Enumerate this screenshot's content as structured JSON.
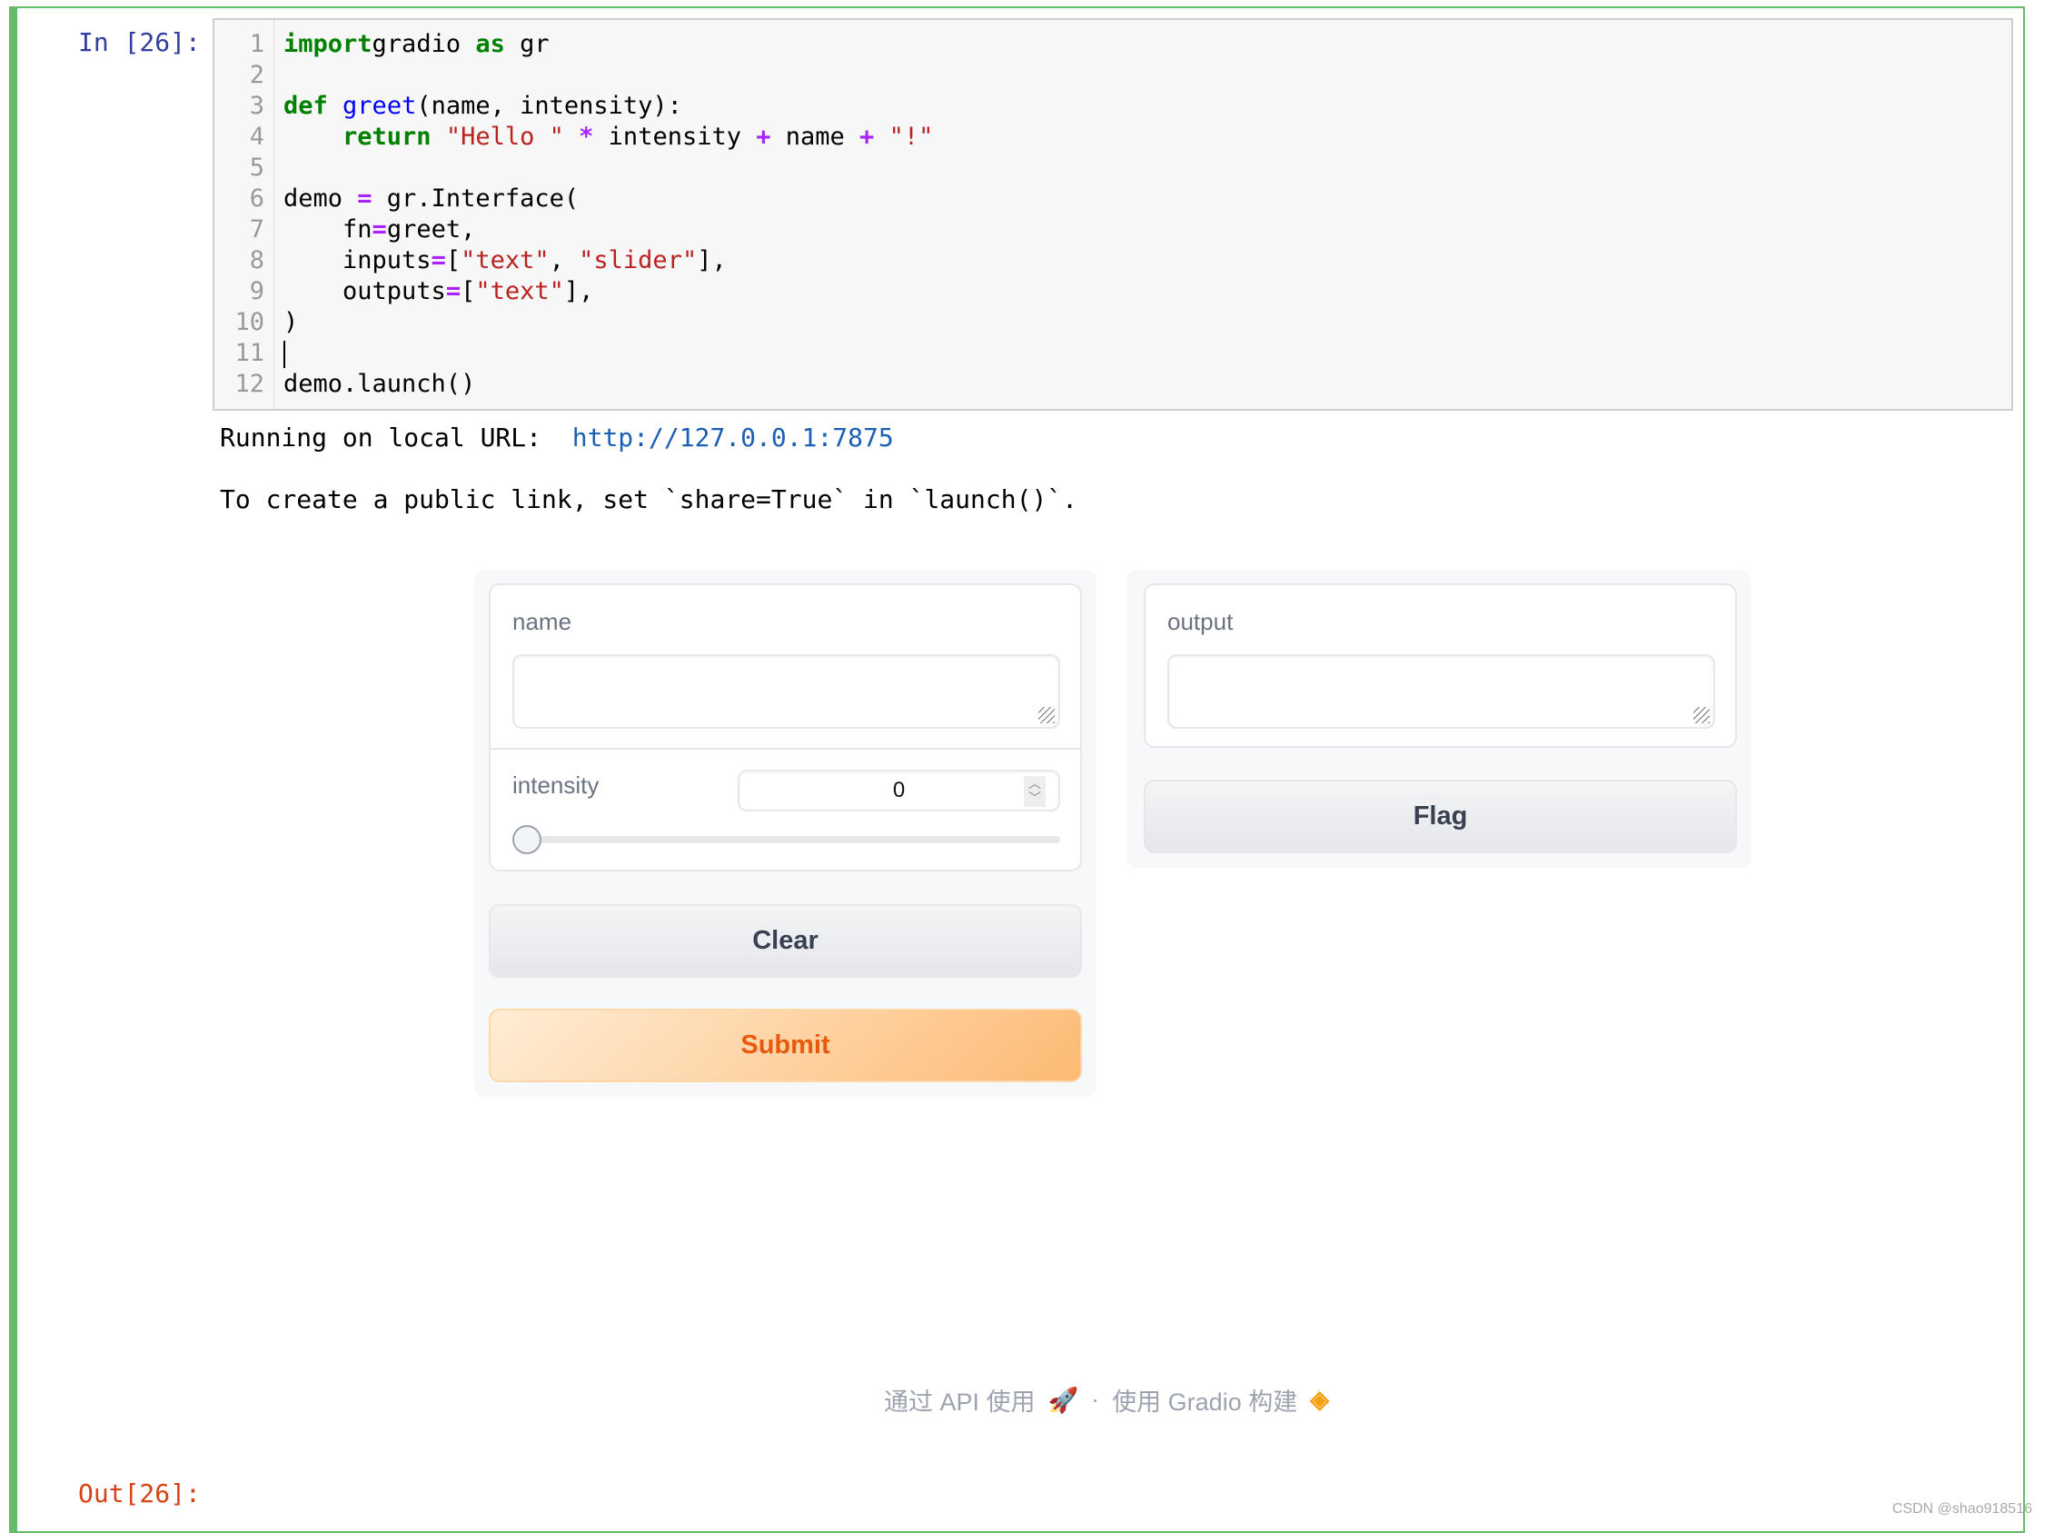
{
  "notebook": {
    "in_prompt": "In [26]:",
    "out_prompt": "Out[26]:",
    "code_lines": [
      [
        [
          "kw",
          "import"
        ],
        [
          "",
          "gradio "
        ],
        [
          "kw",
          "as"
        ],
        [
          "",
          " gr"
        ]
      ],
      [],
      [
        [
          "kw",
          "def"
        ],
        [
          "",
          " "
        ],
        [
          "fn",
          "greet"
        ],
        [
          "",
          "(name, intensity):"
        ]
      ],
      [
        [
          "",
          "    "
        ],
        [
          "kw",
          "return"
        ],
        [
          "",
          " "
        ],
        [
          "st",
          "\"Hello \""
        ],
        [
          "",
          " "
        ],
        [
          "op",
          "*"
        ],
        [
          "",
          " intensity "
        ],
        [
          "op",
          "+"
        ],
        [
          "",
          " name "
        ],
        [
          "op",
          "+"
        ],
        [
          "",
          " "
        ],
        [
          "st",
          "\"!\""
        ]
      ],
      [],
      [
        [
          "",
          "demo "
        ],
        [
          "op",
          "="
        ],
        [
          "",
          " gr.Interface("
        ]
      ],
      [
        [
          "",
          "    fn"
        ],
        [
          "op",
          "="
        ],
        [
          "",
          "greet,"
        ]
      ],
      [
        [
          "",
          "    inputs"
        ],
        [
          "op",
          "="
        ],
        [
          "",
          "["
        ],
        [
          "st",
          "\"text\""
        ],
        [
          "",
          ", "
        ],
        [
          "st",
          "\"slider\""
        ],
        [
          "",
          "],"
        ]
      ],
      [
        [
          "",
          "    outputs"
        ],
        [
          "op",
          "="
        ],
        [
          "",
          "["
        ],
        [
          "st",
          "\"text\""
        ],
        [
          "",
          "],"
        ]
      ],
      [
        [
          "",
          ")"
        ]
      ],
      [],
      [
        [
          "",
          "demo.launch()"
        ]
      ]
    ],
    "output_url_label": "Running on local URL:  ",
    "output_url": "http://127.0.0.1:7875",
    "output_share": "To create a public link, set `share=True` in `launch()`."
  },
  "gradio": {
    "name_label": "name",
    "name_value": "",
    "intensity_label": "intensity",
    "intensity_value": "0",
    "intensity_fraction": 0,
    "clear_label": "Clear",
    "submit_label": "Submit",
    "output_label": "output",
    "output_value": "",
    "flag_label": "Flag",
    "footer_api": "通过 API 使用",
    "footer_sep": "·",
    "footer_built": "使用 Gradio 构建"
  },
  "watermark": "CSDN @shao918516",
  "colors": {
    "cell_border": "#66bb6a",
    "primary": "#ea580c",
    "link": "#1a5fb4"
  }
}
